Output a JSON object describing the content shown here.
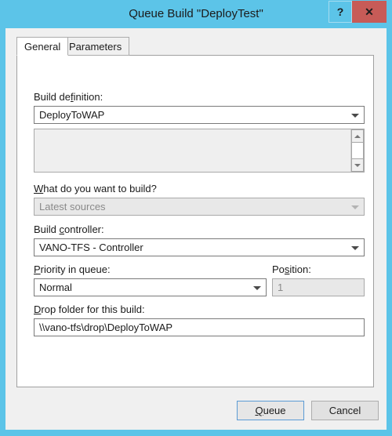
{
  "window": {
    "title": "Queue Build \"DeployTest\"",
    "accent_color": "#5cc4e8",
    "close_color": "#c75b57",
    "body_color": "#f0f0f0"
  },
  "titlebar": {
    "help_label": "?",
    "close_label": "✕"
  },
  "tabs": [
    {
      "label": "General",
      "selected": true
    },
    {
      "label": "Parameters",
      "selected": false
    }
  ],
  "fields": {
    "build_definition": {
      "label_pre": "Build de",
      "label_accel": "f",
      "label_post": "inition:",
      "value": "DeployToWAP",
      "enabled": true
    },
    "what_to_build": {
      "label_pre": "",
      "label_accel": "W",
      "label_post": "hat do you want to build?",
      "value": "Latest sources",
      "enabled": false
    },
    "build_controller": {
      "label_pre": "Build ",
      "label_accel": "c",
      "label_post": "ontroller:",
      "value": "VANO-TFS - Controller",
      "enabled": true
    },
    "priority_in_queue": {
      "label_pre": "",
      "label_accel": "P",
      "label_post": "riority in queue:",
      "value": "Normal",
      "enabled": true
    },
    "position": {
      "label_pre": "Po",
      "label_accel": "s",
      "label_post": "ition:",
      "value": "1",
      "enabled": false
    },
    "drop_folder": {
      "label_pre": "",
      "label_accel": "D",
      "label_post": "rop folder for this build:",
      "value": "\\\\vano-tfs\\drop\\DeployToWAP",
      "enabled": true
    }
  },
  "listbox": {
    "items": [],
    "scrollbar": {
      "up_glyph": "▲",
      "down_glyph": "▼"
    }
  },
  "buttons": {
    "queue": {
      "pre": "",
      "accel": "Q",
      "post": "ueue",
      "default": true
    },
    "cancel": {
      "pre": "Cancel",
      "accel": "",
      "post": ""
    }
  }
}
